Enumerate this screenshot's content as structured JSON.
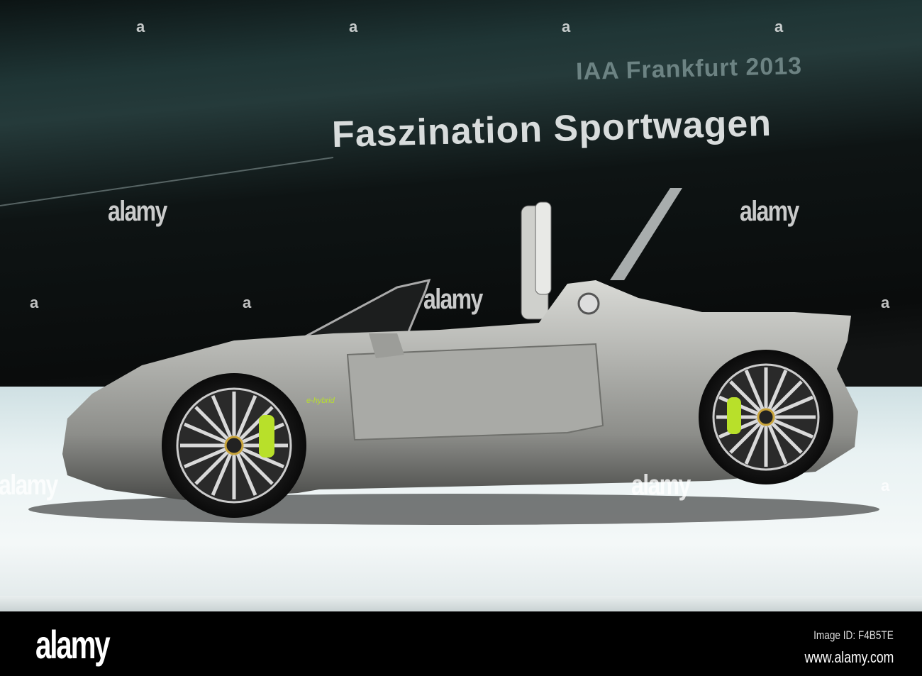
{
  "photo": {
    "screen_text_small": "IAA Frankfurt 2013",
    "screen_text_large": "Faszination Sportwagen",
    "car_badge": "e-hybrid",
    "colors": {
      "body": "#b7b8b5",
      "caliper": "#b8e02a",
      "screen": "#0d1212",
      "floor": "#eef4f4"
    }
  },
  "watermarks": {
    "word": "alamy",
    "letter": "a"
  },
  "footer": {
    "logo": "alamy",
    "image_id": "Image ID: F4B5TE",
    "url": "www.alamy.com"
  }
}
